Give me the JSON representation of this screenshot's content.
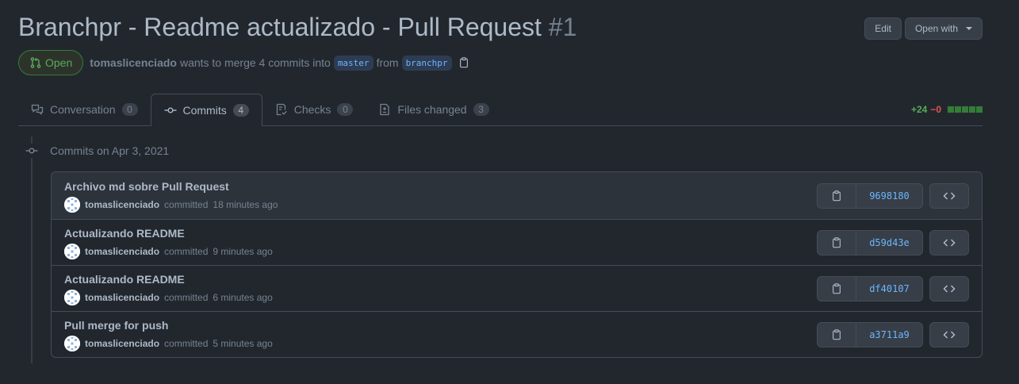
{
  "pr": {
    "title": "Branchpr - Readme actualizado - Pull Request",
    "number": "#1",
    "edit_label": "Edit",
    "open_with_label": "Open with",
    "state": "Open",
    "author": "tomaslicenciado",
    "merge_text": "wants to merge 4 commits into",
    "base_branch": "master",
    "from_text": "from",
    "head_branch": "branchpr"
  },
  "tabs": [
    {
      "label": "Conversation",
      "count": "0",
      "icon": "comment-discussion-icon"
    },
    {
      "label": "Commits",
      "count": "4",
      "icon": "git-commit-icon"
    },
    {
      "label": "Checks",
      "count": "0",
      "icon": "checklist-icon"
    },
    {
      "label": "Files changed",
      "count": "3",
      "icon": "file-diff-icon"
    }
  ],
  "diffstat": {
    "additions": "+24",
    "deletions": "−0"
  },
  "colors": {
    "background": "#22272e",
    "open_green": "#57ab5a",
    "link_blue": "#6cb6ff",
    "delete_red": "#e5534b"
  },
  "group_title": "Commits on Apr 3, 2021",
  "commits": [
    {
      "message": "Archivo md sobre Pull Request",
      "author": "tomaslicenciado",
      "action": "committed",
      "time": "18 minutes ago",
      "sha": "9698180"
    },
    {
      "message": "Actualizando README",
      "author": "tomaslicenciado",
      "action": "committed",
      "time": "9 minutes ago",
      "sha": "d59d43e"
    },
    {
      "message": "Actualizando README",
      "author": "tomaslicenciado",
      "action": "committed",
      "time": "6 minutes ago",
      "sha": "df40107"
    },
    {
      "message": "Pull merge for push",
      "author": "tomaslicenciado",
      "action": "committed",
      "time": "5 minutes ago",
      "sha": "a3711a9"
    }
  ]
}
